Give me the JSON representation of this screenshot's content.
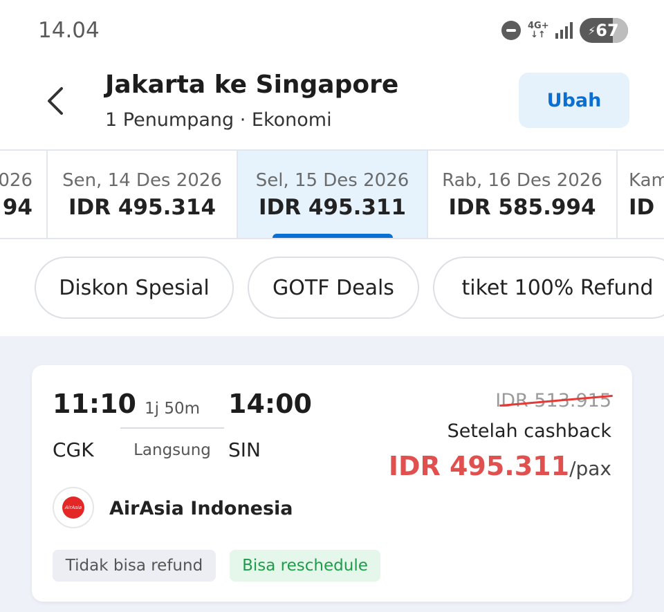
{
  "status_bar": {
    "time": "14.04",
    "network": "4G+",
    "battery": "67"
  },
  "header": {
    "title": "Jakarta ke Singapore",
    "subtitle": "1 Penumpang · Ekonomi",
    "edit_label": "Ubah"
  },
  "date_tabs": [
    {
      "date": "026",
      "price": "94"
    },
    {
      "date": "Sen, 14 Des 2026",
      "price": "IDR 495.314"
    },
    {
      "date": "Sel, 15 Des 2026",
      "price": "IDR 495.311",
      "selected": true
    },
    {
      "date": "Rab, 16 Des 2026",
      "price": "IDR 585.994"
    },
    {
      "date": "Kam",
      "price": "ID"
    }
  ],
  "filter_chips": [
    "Diskon Spesial",
    "GOTF Deals",
    "tiket 100% Refund"
  ],
  "flight": {
    "departure_time": "11:10",
    "arrival_time": "14:00",
    "duration": "1j 50m",
    "type": "Langsung",
    "origin": "CGK",
    "destination": "SIN",
    "original_price": "IDR 513.915",
    "cashback_label": "Setelah cashback",
    "final_price": "IDR 495.311",
    "price_unit": "/pax",
    "airline_logo_text": "AirAsia",
    "airline": "AirAsia Indonesia",
    "badges": [
      "Tidak bisa refund",
      "Bisa reschedule"
    ]
  },
  "colors": {
    "accent": "#0a6fd3",
    "price_red": "#e0504f",
    "selected_tab_bg": "#e6f3fd",
    "reschedule_green": "#1f9b4a"
  }
}
